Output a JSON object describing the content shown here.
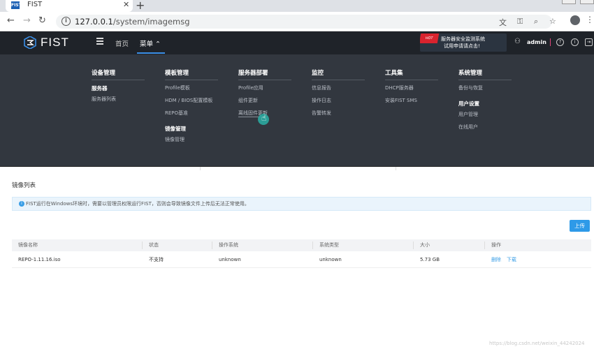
{
  "browser": {
    "tab_title": "FIST",
    "favicon_text": "FIST",
    "url_host": "127.0.0.1",
    "url_path": "/system/imagemsg"
  },
  "header": {
    "logo_text": "FIST",
    "nav_home": "首页",
    "nav_menu": "菜单",
    "ad_hot": "HOT",
    "ad_line1": "服务器安全监测系统",
    "ad_line2": "试用申请请点击!",
    "username": "admin"
  },
  "menu": {
    "columns": [
      {
        "title": "设备管理",
        "group": "服务器",
        "items": [
          "服务器列表"
        ]
      },
      {
        "title": "模板管理",
        "items": [
          "Profile模板",
          "HDM / BIOS配置模板",
          "REPO基准"
        ],
        "group2": "镜像管理",
        "items2": [
          "镜像管理"
        ]
      },
      {
        "title": "服务器部署",
        "items": [
          "Profile应用",
          "组件更新",
          "离线固件更新"
        ]
      },
      {
        "title": "监控",
        "items": [
          "信息报告",
          "操作日志",
          "告警转发"
        ]
      },
      {
        "title": "工具集",
        "items": [
          "DHCP服务器",
          "安装FIST SMS"
        ]
      },
      {
        "title": "系统管理",
        "items": [
          "备份与恢复"
        ],
        "group2": "用户设置",
        "items2": [
          "用户管理",
          "在线用户"
        ]
      }
    ]
  },
  "page": {
    "title": "镜像列表",
    "notice": "FIST运行在Windows环境时，需要以管理员权限运行FIST，否则会导致镜像文件上传后无法正常使用。",
    "upload_label": "上传"
  },
  "table": {
    "headers": [
      "镜像名称",
      "状态",
      "操作系统",
      "系统类型",
      "大小",
      "操作"
    ],
    "rows": [
      {
        "name": "REPO-1.11.16.iso",
        "status": "不支持",
        "os": "unknown",
        "os_type": "unknown",
        "size": "5.73 GB",
        "delete": "删除",
        "download": "下载"
      }
    ]
  },
  "watermark": "https://blog.csdn.net/weixin_44242024"
}
